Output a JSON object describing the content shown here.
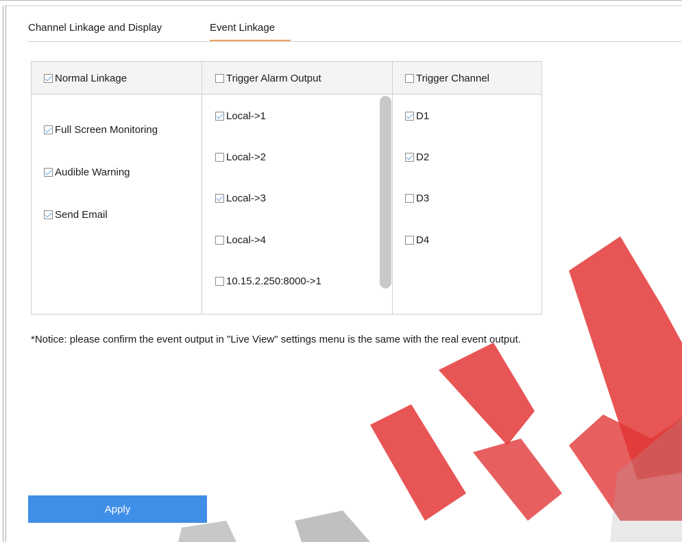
{
  "tabs": [
    {
      "label": "Channel Linkage and Display",
      "active": false
    },
    {
      "label": "Event Linkage",
      "active": true
    }
  ],
  "table": {
    "columns": [
      {
        "label": "Normal Linkage",
        "checked": true
      },
      {
        "label": "Trigger Alarm Output",
        "checked": false
      },
      {
        "label": "Trigger Channel",
        "checked": false
      }
    ],
    "normal_linkage": [
      {
        "label": "Full Screen Monitoring",
        "checked": true
      },
      {
        "label": "Audible Warning",
        "checked": true
      },
      {
        "label": "Send Email",
        "checked": true
      }
    ],
    "alarm_outputs": [
      {
        "label": "Local->1",
        "checked": true
      },
      {
        "label": "Local->2",
        "checked": false
      },
      {
        "label": "Local->3",
        "checked": true
      },
      {
        "label": "Local->4",
        "checked": false
      },
      {
        "label": "10.15.2.250:8000->1",
        "checked": false
      }
    ],
    "channels": [
      {
        "label": "D1",
        "checked": true
      },
      {
        "label": "D2",
        "checked": true
      },
      {
        "label": "D3",
        "checked": false
      },
      {
        "label": "D4",
        "checked": false
      }
    ]
  },
  "notice": "*Notice: please confirm the event output in \"Live View\" settings menu is the same with the real event output.",
  "apply_label": "Apply",
  "colors": {
    "accent": "#3f8ee8",
    "tab_underline": "#f0a35b",
    "check": "#6ba7e0",
    "watermark_red": "#e02020",
    "watermark_gray": "#9a9a9a"
  }
}
